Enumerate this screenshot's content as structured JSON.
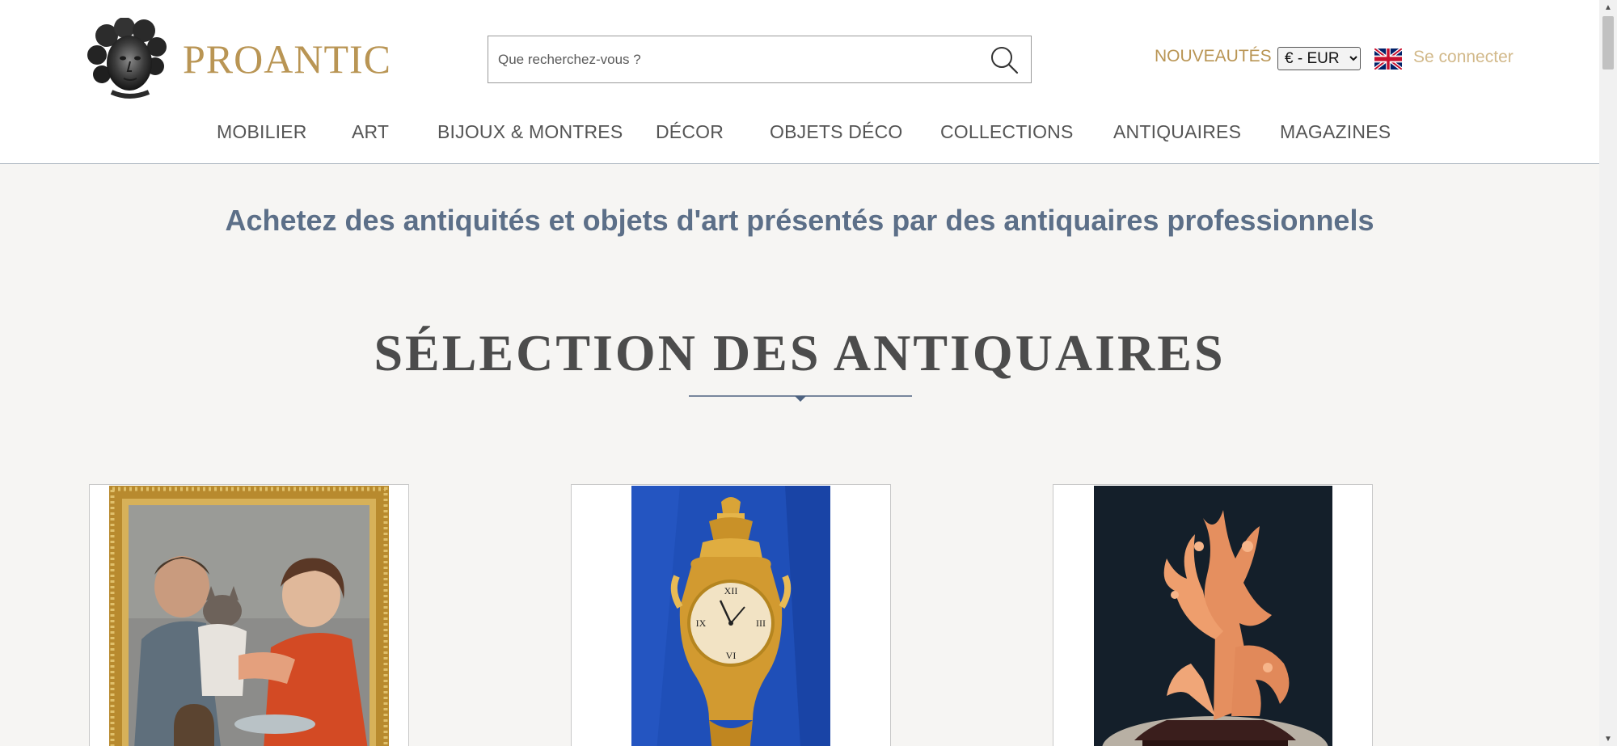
{
  "brand": {
    "name": "PROANTIC",
    "color": "#b99554"
  },
  "search": {
    "placeholder": "Que recherchez-vous ?",
    "icon": "search-icon"
  },
  "header_links": {
    "new_label": "NOUVEAUTÉS",
    "currency_selected": "€ - EUR",
    "language_flag": "uk-flag-icon",
    "login_label": "Se connecter"
  },
  "nav": {
    "items": [
      {
        "label": "MOBILIER"
      },
      {
        "label": "ART"
      },
      {
        "label": "BIJOUX & MONTRES"
      },
      {
        "label": "DÉCOR"
      },
      {
        "label": "OBJETS DÉCO"
      },
      {
        "label": "COLLECTIONS"
      },
      {
        "label": "ANTIQUAIRES"
      },
      {
        "label": "MAGAZINES"
      }
    ]
  },
  "main": {
    "tagline": "Achetez des antiquités et objets d'art présentés par des antiquaires professionnels",
    "section_title": "SÉLECTION DES ANTIQUAIRES"
  },
  "products": [
    {
      "image": "painting-children-with-cat"
    },
    {
      "image": "gilt-bronze-cartel-clock"
    },
    {
      "image": "carved-coral-sculpture"
    }
  ],
  "colors": {
    "accent_gold": "#b99554",
    "tagline_blue": "#5c6f88",
    "divider_blue": "#4d6280",
    "page_bg": "#f6f5f3"
  }
}
